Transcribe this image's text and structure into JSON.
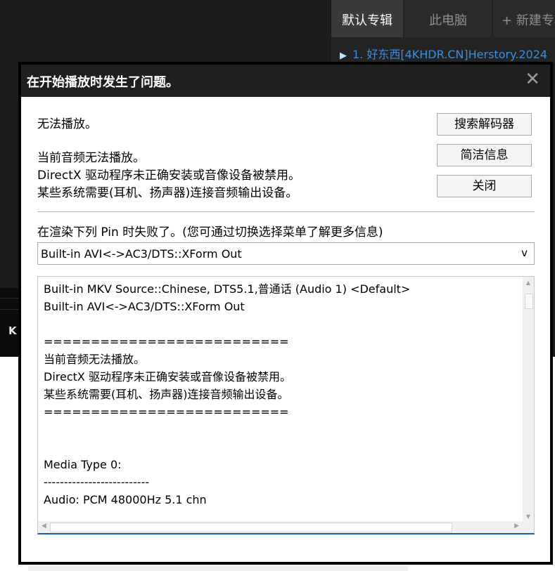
{
  "background_app": {
    "tabs": [
      {
        "label": "默认专辑",
        "active": true
      },
      {
        "label": "此电脑",
        "active": false
      },
      {
        "label": "+ 新建专辑",
        "active": false
      }
    ],
    "playlist_item": "1. 好东西[4KHDR.CN]Herstory.2024",
    "left_char": "K"
  },
  "dialog": {
    "title": "在开始播放时发生了问题。",
    "close_symbol": "✕",
    "message_heading": "无法播放。",
    "message_lines": [
      "当前音频无法播放。",
      "DirectX 驱动程序未正确安装或音像设备被禁用。",
      "某些系统需要(耳机、扬声器)连接音频输出设备。"
    ],
    "buttons": {
      "search_decoder": "搜索解码器",
      "brief_info": "简洁信息",
      "close": "关闭"
    },
    "pin_label": "在渲染下列 Pin 时失败了。(您可通过切换选择菜单了解更多信息)",
    "pin_select": {
      "value": "Built-in AVI<->AC3/DTS::XForm Out",
      "arrow": "v"
    },
    "details_lines": [
      "Built-in MKV Source::Chinese, DTS5.1,普通话 (Audio 1) <Default>",
      "Built-in AVI<->AC3/DTS::XForm Out",
      "",
      "==========================",
      "当前音频无法播放。",
      "DirectX 驱动程序未正确安装或音像设备被禁用。",
      "某些系统需要(耳机、扬声器)连接音频输出设备。",
      "==========================",
      "",
      "",
      "Media Type 0:",
      "--------------------------",
      "Audio: PCM 48000Hz 5.1 chn"
    ]
  }
}
